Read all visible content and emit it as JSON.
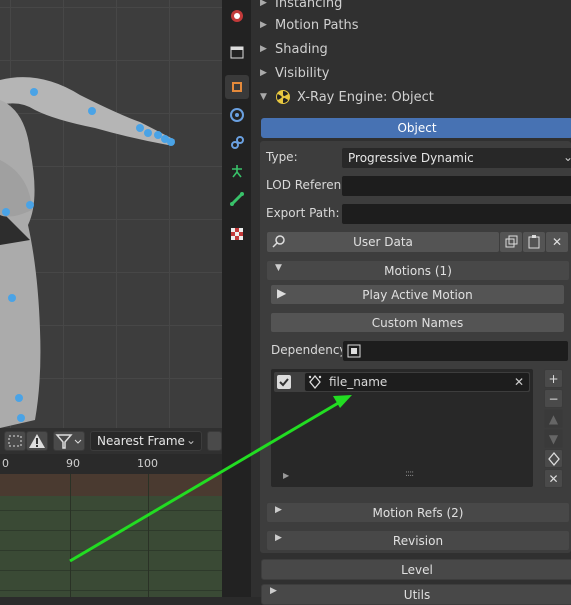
{
  "timeline": {
    "interpolation": "Nearest Frame",
    "ruler_ticks": [
      "0",
      "90",
      "100"
    ]
  },
  "properties": {
    "sections": [
      "Instancing",
      "Motion Paths",
      "Shading",
      "Visibility"
    ],
    "xray_header": "X-Ray Engine: Object",
    "object_tab": "Object",
    "type_label": "Type:",
    "type_value": "Progressive Dynamic",
    "lod_label": "LOD Referen...",
    "lod_value": "",
    "export_label": "Export Path:",
    "export_value": "",
    "user_data": "User Data",
    "motions_header": "Motions (1)",
    "play_active_motion": "Play Active Motion",
    "custom_names": "Custom Names",
    "dependency_label": "Dependency:",
    "motion_items": [
      {
        "name": "file_name",
        "checked": true
      }
    ],
    "motion_refs_header": "Motion Refs (2)",
    "revision_header": "Revision",
    "level_button": "Level",
    "utils_header": "Utils"
  },
  "colors": {
    "accent": "#4772b3",
    "annotation_arrow": "#22dd22",
    "timeline_tracks": "#3a4a35"
  }
}
